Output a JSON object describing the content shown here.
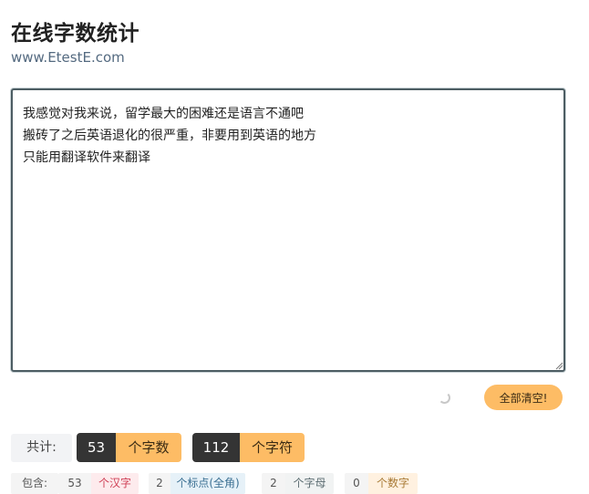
{
  "header": {
    "title": "在线字数统计",
    "site": "www.EtestE.com"
  },
  "editor": {
    "text": "我感觉对我来说，留学最大的困难还是语言不通吧\n搬砖了之后英语退化的很严重，非要用到英语的地方\n只能用翻译软件来翻译"
  },
  "actions": {
    "clear_label": "全部清空!"
  },
  "totals": {
    "label": "共计:",
    "char_count": "53",
    "char_unit": "个字数",
    "symbol_count": "112",
    "symbol_unit": "个字符"
  },
  "breakdown": {
    "label": "包含:",
    "items": [
      {
        "count": "53",
        "unit": "个汉字"
      },
      {
        "count": "2",
        "unit": "个标点(全角)"
      },
      {
        "count": "2",
        "unit": "个字母"
      },
      {
        "count": "0",
        "unit": "个数字"
      }
    ]
  },
  "colors": {
    "accent": "#fdbc65",
    "dark": "#343434",
    "editor_border": "#4d5d63"
  }
}
